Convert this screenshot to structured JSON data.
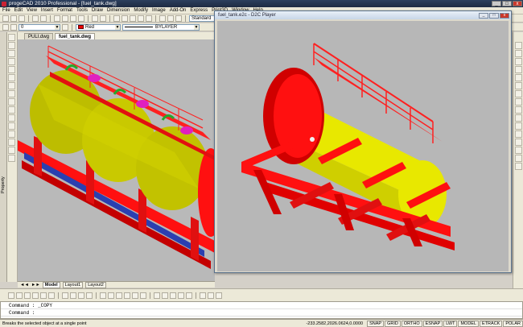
{
  "window": {
    "title": "progeCAD 2010 Professional - [fuel_tank.dwg]",
    "minimize": "_",
    "maximize": "□",
    "close": "x"
  },
  "menu": [
    "File",
    "Edit",
    "View",
    "Insert",
    "Format",
    "Tools",
    "Draw",
    "Dimension",
    "Modify",
    "Image",
    "Add-On",
    "Express",
    "Print3D",
    "Window",
    "Help"
  ],
  "toolbar": {
    "layer_value": "0",
    "text_style": "Standard",
    "color_value": "Red",
    "linetype_value": "BYLAYER"
  },
  "doc_tabs": [
    "PULI.dwg",
    "fuel_tank.dwg"
  ],
  "layout_tabs": [
    "Model",
    "Layout1",
    "Layout2"
  ],
  "side_panel": {
    "label": "Property"
  },
  "d2c_window": {
    "title": "fuel_tank.e2c - D2C Player",
    "close": "x"
  },
  "command": {
    "line1": "Command : _COPY",
    "line2": "Command :"
  },
  "status": {
    "message": "Breaks the selected object at a single point",
    "coordinates": "-233.2582,2026.0624,0.0000",
    "buttons": [
      "SNAP",
      "GRID",
      "ORTHO",
      "ESNAP",
      "LWT",
      "MODEL",
      "ETRACK",
      "POLAR"
    ]
  },
  "colors": {
    "tank_yellow": "#e8e800",
    "frame_red": "#ff1010",
    "background_gray": "#b8b8b8"
  }
}
